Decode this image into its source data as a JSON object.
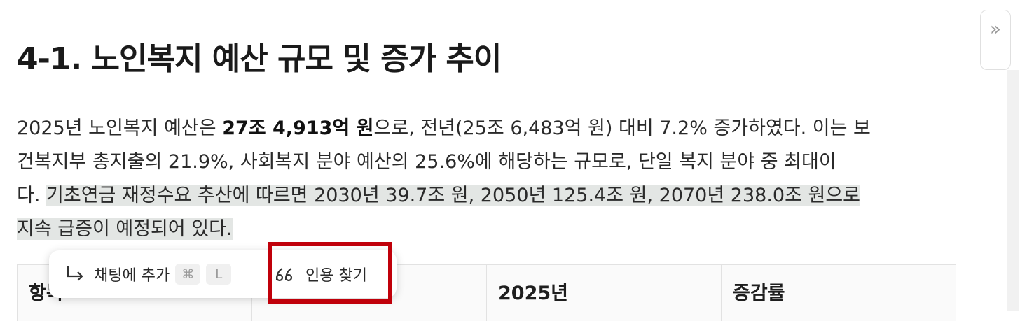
{
  "doc": {
    "heading": "4-1. 노인복지 예산 규모 및 증가 추이",
    "paragraph": {
      "line1_a": "2025년 노인복지 예산은 ",
      "line1_bold": "27조 4,913억 원",
      "line1_b": "으로, 전년(25조 6,483억 원) 대비 7.2% 증가하였다. 이는 보",
      "line2": "건복지부 총지출의 21.9%, 사회복지 분야 예산의 25.6%에 해당하는 규모로, 단일 복지 분야 중 최대이",
      "line3_a": "다. ",
      "line3_hl": "기초연금 재정수요 추산에 따르면 2030년 39.7조 원, 2050년 125.4조 원, 2070년 238.0조 원으로",
      "line4_hl": "지속 급증이 예정되어 있다."
    },
    "table": {
      "headers": [
        "항목",
        "",
        "2025년",
        "증감률"
      ]
    }
  },
  "selection_toolbar": {
    "add_to_chat_label": "채팅에 추가",
    "shortcut_cmd": "⌘",
    "shortcut_key": "L",
    "find_citation_label": "인용 찾기",
    "add_icon": "arrow-return-icon",
    "cite_icon": "quote-icon",
    "highlight_color": "#c0000a"
  },
  "sidebar_toggle": {
    "label": "»",
    "icon": "double-chevron-right-icon"
  }
}
